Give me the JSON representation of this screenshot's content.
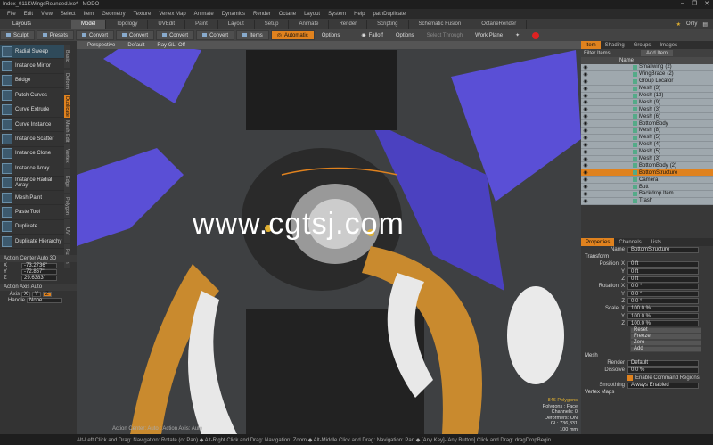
{
  "window": {
    "title": "Index_011KWingsRounded.lxo* - MODO",
    "controls": [
      "–",
      "❐",
      "✕"
    ]
  },
  "menu": [
    "File",
    "Edit",
    "View",
    "Select",
    "Item",
    "Geometry",
    "Texture",
    "Vertex Map",
    "Animate",
    "Dynamics",
    "Render",
    "Octane",
    "Layout",
    "System",
    "Help",
    "pathDuplicate"
  ],
  "layout": {
    "label": "Layouts",
    "tabs": [
      "Model",
      "Topology",
      "UVEdit",
      "Paint",
      "Layout",
      "Setup",
      "Animate",
      "Render",
      "Scripting",
      "Schematic Fusion",
      "OctaneRender"
    ],
    "active": 0,
    "only": "Only"
  },
  "toolbar": {
    "sculpt": "Sculpt",
    "presets": "Presets",
    "convert1": "Convert",
    "convert2": "Convert",
    "convert3": "Convert",
    "convert4": "Convert",
    "items": "Items",
    "automatic": "Automatic",
    "options1": "Options",
    "falloff": "Falloff",
    "options2": "Options",
    "select_through": "Select Through",
    "work_plane": "Work Plane"
  },
  "tools": [
    "Radial Sweep",
    "Instance Mirror",
    "Bridge",
    "Patch Curves",
    "Curve Extrude",
    "Curve Instance",
    "Instance Scatter",
    "Instance Clone",
    "Instance Array",
    "Instance Radial Array",
    "Mesh Paint",
    "Paste Tool",
    "Duplicate",
    "Duplicate Hierarchy"
  ],
  "vtabs": [
    "Basic",
    "Deform",
    "Duplicate",
    "Mesh Edit",
    "Vertex",
    "Edge",
    "Polygon",
    "UV",
    "Fusion"
  ],
  "action_center": {
    "title": "Action Center Auto 3D",
    "values": [
      "-73.2736\"",
      "-72.857\"",
      "29.6383\""
    ],
    "axis_title": "Action Axis Auto",
    "axis_label": "Axis",
    "axis": [
      "X",
      "Y",
      "Z"
    ],
    "handle_label": "Handle",
    "handle": "None"
  },
  "viewport": {
    "tabs": [
      "Perspective",
      "Default",
      "Ray GL: Off"
    ],
    "watermark": "www.cgtsj.com",
    "stats": {
      "polygons": "846 Polygons",
      "face": "Polygons : Face",
      "channels": "Channels: 0",
      "deformers": "Deformers: ON",
      "gl": "GL: 736,831"
    },
    "action_label": "Action Center: Auto : Action Axis: Auto",
    "grid_label": "100 mm"
  },
  "right_tabs": [
    "Item",
    "Shading",
    "Groups",
    "Images"
  ],
  "filter": {
    "label": "Filter Items",
    "add": "Add Item"
  },
  "item_header": "Name",
  "items": [
    {
      "name": "Smallwing",
      "count": "(2)"
    },
    {
      "name": "WingBrace",
      "count": "(2)"
    },
    {
      "name": "Group Locator",
      "count": ""
    },
    {
      "name": "Mesh",
      "count": "(3)"
    },
    {
      "name": "Mesh",
      "count": "(13)"
    },
    {
      "name": "Mesh",
      "count": "(9)"
    },
    {
      "name": "Mesh",
      "count": "(3)"
    },
    {
      "name": "Mesh",
      "count": "(6)"
    },
    {
      "name": "BottomBody",
      "count": ""
    },
    {
      "name": "Mesh",
      "count": "(8)"
    },
    {
      "name": "Mesh",
      "count": "(5)"
    },
    {
      "name": "Mesh",
      "count": "(4)"
    },
    {
      "name": "Mesh",
      "count": "(5)"
    },
    {
      "name": "Mesh",
      "count": "(3)"
    },
    {
      "name": "BottomBody",
      "count": "(2)"
    },
    {
      "name": "BottomStructure",
      "count": ""
    },
    {
      "name": "Camera",
      "count": ""
    },
    {
      "name": "Butt",
      "count": ""
    },
    {
      "name": "Backdrop Item",
      "count": ""
    },
    {
      "name": "Trash",
      "count": ""
    }
  ],
  "prop_tabs": [
    "Properties",
    "Channels",
    "Lists"
  ],
  "props": {
    "name_label": "Name",
    "name": "BottomStructure",
    "transform": "Transform",
    "position": "Position",
    "rotation": "Rotation",
    "scale": "Scale",
    "pos": [
      "0 ft",
      "0 ft",
      "0 ft"
    ],
    "rot": [
      "0.0 °",
      "0.0 °",
      "0.0 °"
    ],
    "scl": [
      "100.0 %",
      "100.0 %",
      "100.0 %"
    ],
    "axes": [
      "X",
      "Y",
      "Z"
    ],
    "buttons": [
      "Reset",
      "Freeze",
      "Zero",
      "Add"
    ],
    "mesh": "Mesh",
    "render_label": "Render",
    "render": "Default",
    "dissolve_label": "Dissolve",
    "dissolve": "0.0 %",
    "enable_cmd": "Enable Command Regions",
    "smoothing_label": "Smoothing",
    "smoothing": "Always Enabled",
    "vertex_maps": "Vertex Maps"
  },
  "right_vtabs": [
    "Mesh",
    "Surface",
    "Curve",
    "Display",
    "Assembly",
    "User Channels",
    "Tags"
  ],
  "status": "Alt-Left Click and Drag: Navigation: Rotate (or Pan) ◆ Alt-Right Click and Drag: Navigation: Zoom ◆ Alt-Middle Click and Drag: Navigation: Pan ◆ [Any Key]-[Any Button] Click and Drag: dragDropBegin"
}
